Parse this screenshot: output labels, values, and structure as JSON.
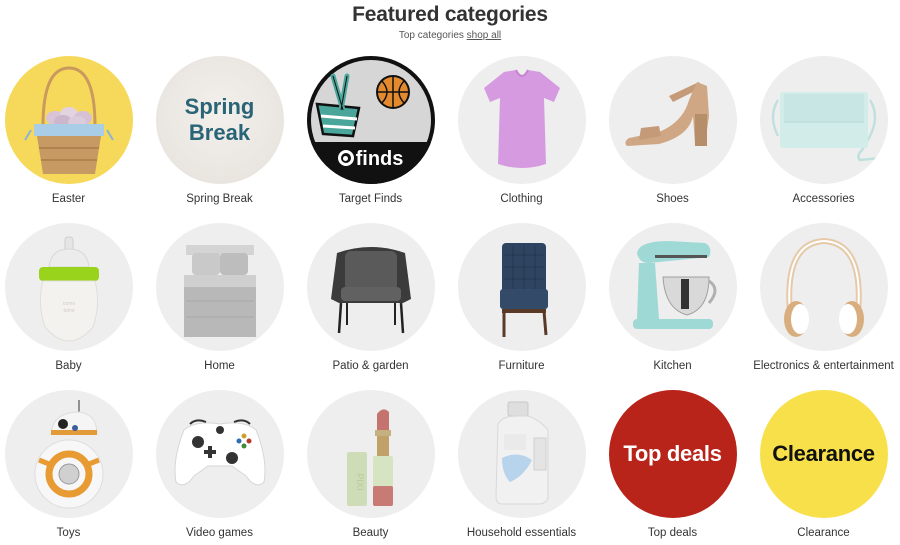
{
  "header": {
    "title": "Featured categories",
    "subtitle_prefix": "Top categories",
    "shop_all_link": "shop all"
  },
  "categories": [
    {
      "label": "Easter",
      "icon": "easter-basket-icon",
      "bg": "#f6d95a"
    },
    {
      "label": "Spring Break",
      "icon": "spring-break-icon",
      "bg": "#ece8e3",
      "art_text_line1": "Spring",
      "art_text_line2": "Break",
      "art_color": "#2a6577"
    },
    {
      "label": "Target Finds",
      "icon": "target-finds-icon",
      "bg": "#d5d5d5",
      "art_text": "finds"
    },
    {
      "label": "Clothing",
      "icon": "tshirt-icon",
      "bg": "#eeeeee"
    },
    {
      "label": "Shoes",
      "icon": "sandal-icon",
      "bg": "#eeeeee"
    },
    {
      "label": "Accessories",
      "icon": "handbag-icon",
      "bg": "#eeeeee"
    },
    {
      "label": "Baby",
      "icon": "baby-bottle-icon",
      "bg": "#eeeeee"
    },
    {
      "label": "Home",
      "icon": "bed-icon",
      "bg": "#eeeeee"
    },
    {
      "label": "Patio & garden",
      "icon": "patio-chair-icon",
      "bg": "#eeeeee"
    },
    {
      "label": "Furniture",
      "icon": "armchair-icon",
      "bg": "#eeeeee"
    },
    {
      "label": "Kitchen",
      "icon": "stand-mixer-icon",
      "bg": "#eeeeee"
    },
    {
      "label": "Electronics & entertainment",
      "icon": "headphones-icon",
      "bg": "#eeeeee"
    },
    {
      "label": "Toys",
      "icon": "robot-toy-icon",
      "bg": "#eeeeee"
    },
    {
      "label": "Video games",
      "icon": "game-controller-icon",
      "bg": "#eeeeee"
    },
    {
      "label": "Beauty",
      "icon": "lipstick-icon",
      "bg": "#eeeeee"
    },
    {
      "label": "Household essentials",
      "icon": "detergent-bottle-icon",
      "bg": "#eeeeee"
    },
    {
      "label": "Top deals",
      "icon": "top-deals-badge",
      "bg": "#b8231a",
      "art_text": "Top deals",
      "art_color": "#ffffff"
    },
    {
      "label": "Clearance",
      "icon": "clearance-badge",
      "bg": "#f7e04a",
      "art_text": "Clearance",
      "art_color": "#111111"
    }
  ]
}
